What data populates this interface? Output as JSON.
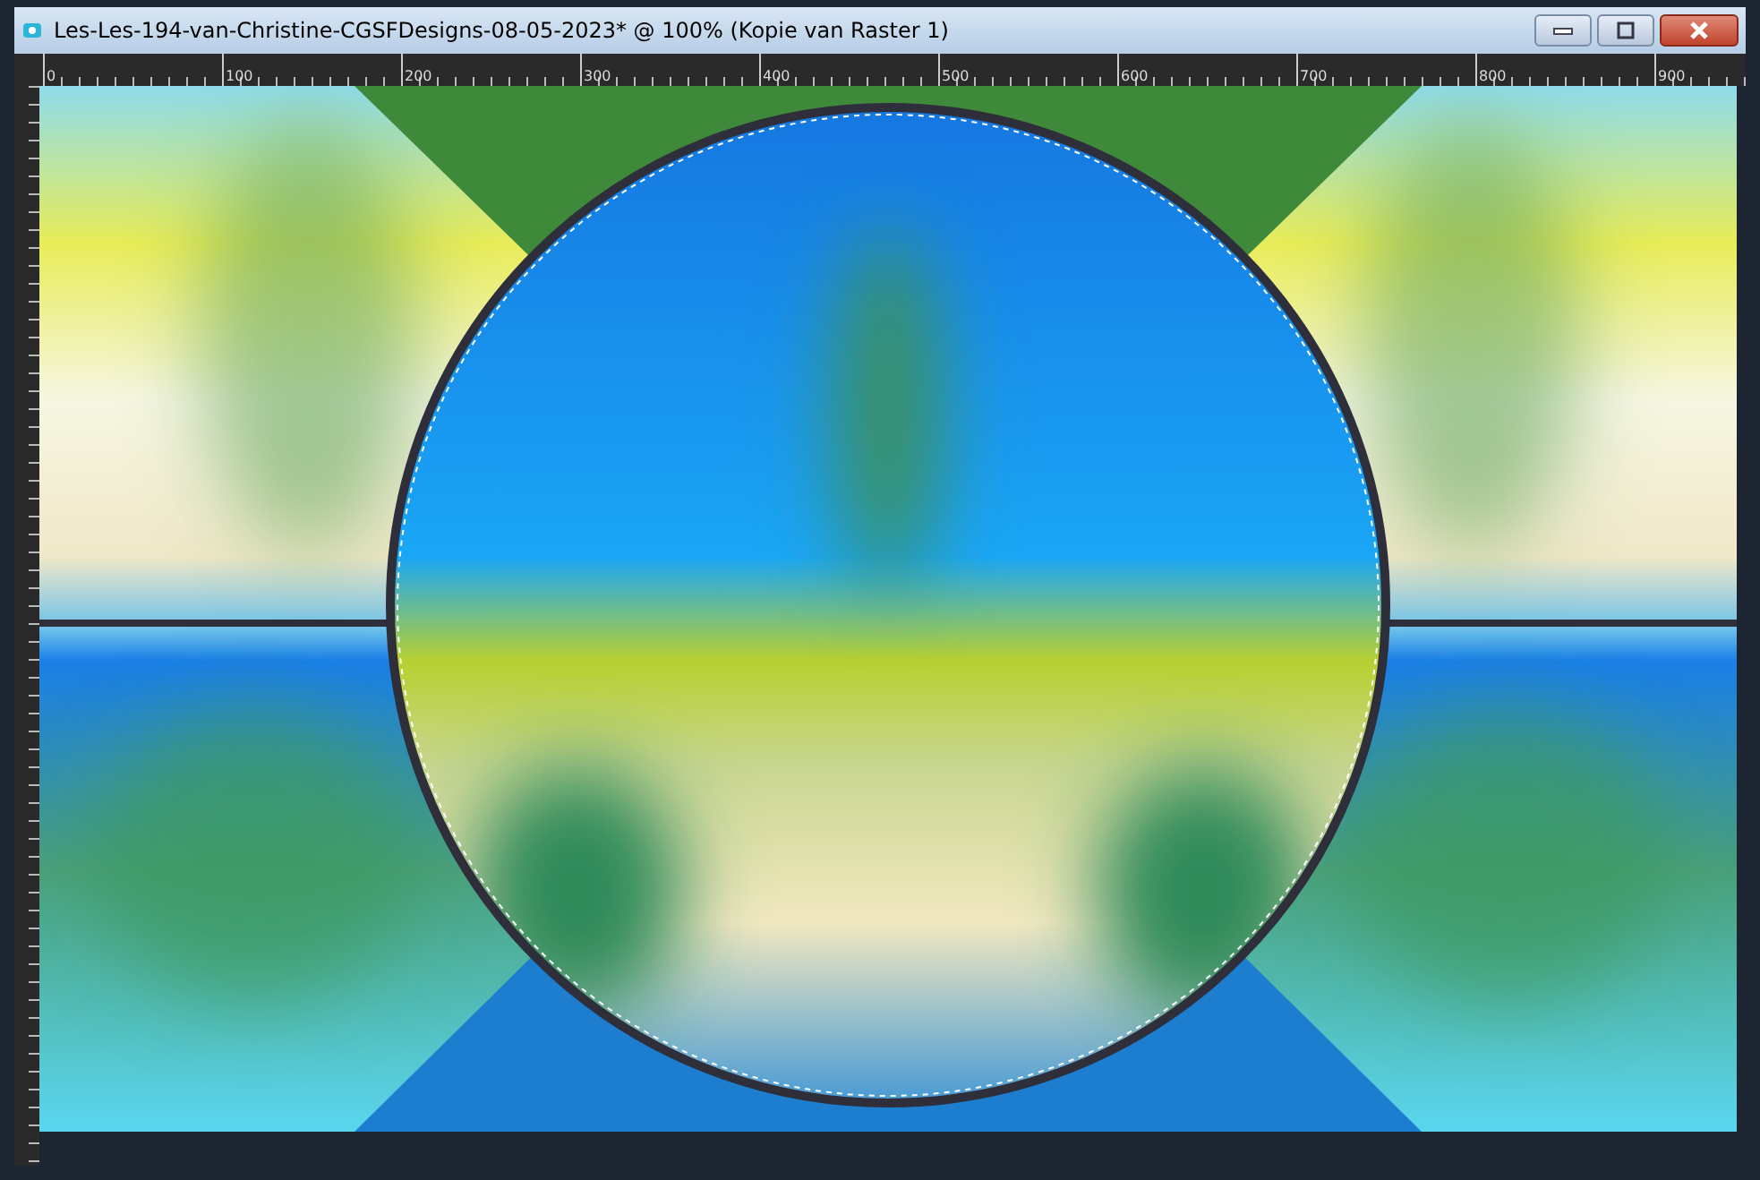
{
  "window": {
    "title": "Les-Les-194-van-Christine-CGSFDesigns-08-05-2023* @ 100% (Kopie van Raster 1)"
  },
  "ruler": {
    "labels": [
      "0",
      "100",
      "200",
      "300",
      "400",
      "500",
      "600",
      "700",
      "800",
      "900"
    ]
  }
}
